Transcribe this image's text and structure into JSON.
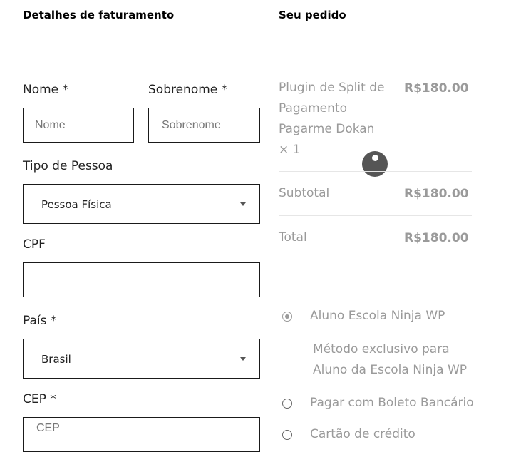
{
  "billing": {
    "title": "Detalhes de faturamento",
    "first_name": {
      "label": "Nome *",
      "placeholder": "Nome"
    },
    "last_name": {
      "label": "Sobrenome *",
      "placeholder": "Sobrenome"
    },
    "person_type": {
      "label": "Tipo de Pessoa",
      "value": "Pessoa Física"
    },
    "cpf": {
      "label": "CPF",
      "placeholder": ""
    },
    "country": {
      "label": "País *",
      "value": "Brasil"
    },
    "cep": {
      "label": "CEP *",
      "placeholder": "CEP"
    }
  },
  "order": {
    "title": "Seu pedido",
    "item": {
      "name_lines": [
        "Plugin de Split de",
        "Pagamento",
        "Pagarme Dokan"
      ],
      "qty": "× 1",
      "price": "R$180.00"
    },
    "subtotal": {
      "label": "Subtotal",
      "value": "R$180.00"
    },
    "total": {
      "label": "Total",
      "value": "R$180.00"
    }
  },
  "payment": {
    "methods": [
      {
        "label": "Aluno Escola Ninja WP",
        "selected": true
      },
      {
        "label": "Pagar com Boleto Bancário",
        "selected": false
      },
      {
        "label": "Cartão de crédito",
        "selected": false
      }
    ],
    "description_lines": [
      "Método exclusivo para",
      "Aluno da Escola Ninja WP"
    ]
  },
  "icons": {
    "spinner": "loading-spinner-icon",
    "caret": "chevron-down-icon"
  }
}
